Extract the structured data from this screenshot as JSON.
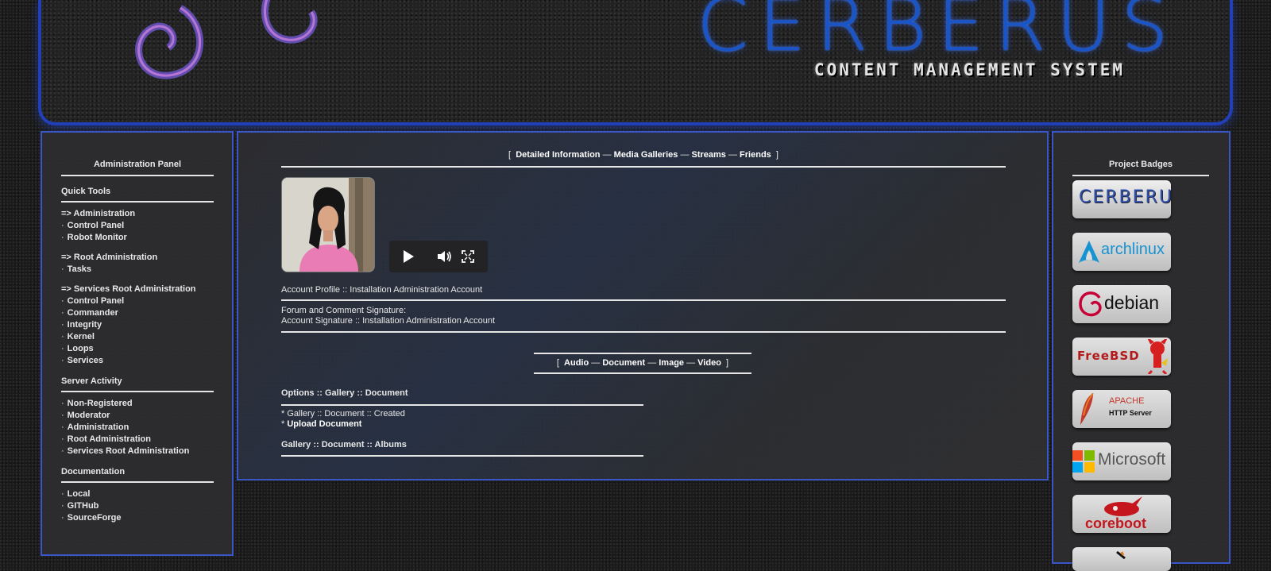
{
  "banner": {
    "brand": "CERBERUS",
    "tagline": "CONTENT MANAGEMENT SYSTEM"
  },
  "left_panel": {
    "title": "Administration Panel",
    "quick_tools": {
      "heading": "Quick Tools",
      "groups": [
        {
          "label": "=> Administration",
          "items": [
            "Control Panel",
            "Robot Monitor"
          ]
        },
        {
          "label": "=> Root Administration",
          "items": [
            "Tasks"
          ]
        },
        {
          "label": "=> Services Root Administration",
          "items": [
            "Control Panel",
            "Commander",
            "Integrity",
            "Kernel",
            "Loops",
            "Services"
          ]
        }
      ]
    },
    "server_activity": {
      "heading": "Server Activity",
      "items": [
        "Non-Registered",
        "Moderator",
        "Administration",
        "Root Administration",
        "Services Root Administration"
      ]
    },
    "documentation": {
      "heading": "Documentation",
      "items": [
        "Local",
        "GITHub",
        "SourceForge"
      ]
    }
  },
  "center": {
    "nav": [
      "Detailed Information",
      "Media Galleries",
      "Streams",
      "Friends"
    ],
    "avatar_alt": "profile photo",
    "account_profile": "Account Profile :: Installation Administration Account",
    "signature_label": "Forum and Comment Signature:",
    "signature_value": "Account Signature :: Installation Administration Account",
    "media_nav": [
      "Audio",
      "Document",
      "Image",
      "Video"
    ],
    "options_heading": "Options :: Gallery :: Document",
    "gallery_created": "* Gallery :: Document :: Created",
    "upload_prefix": "* ",
    "upload_link": "Upload Document",
    "albums_heading": "Gallery :: Document :: Albums"
  },
  "right_panel": {
    "title": "Project Badges",
    "badges": [
      "CERBERUS",
      "archlinux",
      "debian",
      "FreeBSD",
      "APACHE",
      "HTTP Server",
      "Microsoft",
      "coreboot"
    ]
  },
  "colors": {
    "accent_blue": "#3a56c6",
    "brand_blue": "#1a55c8"
  }
}
